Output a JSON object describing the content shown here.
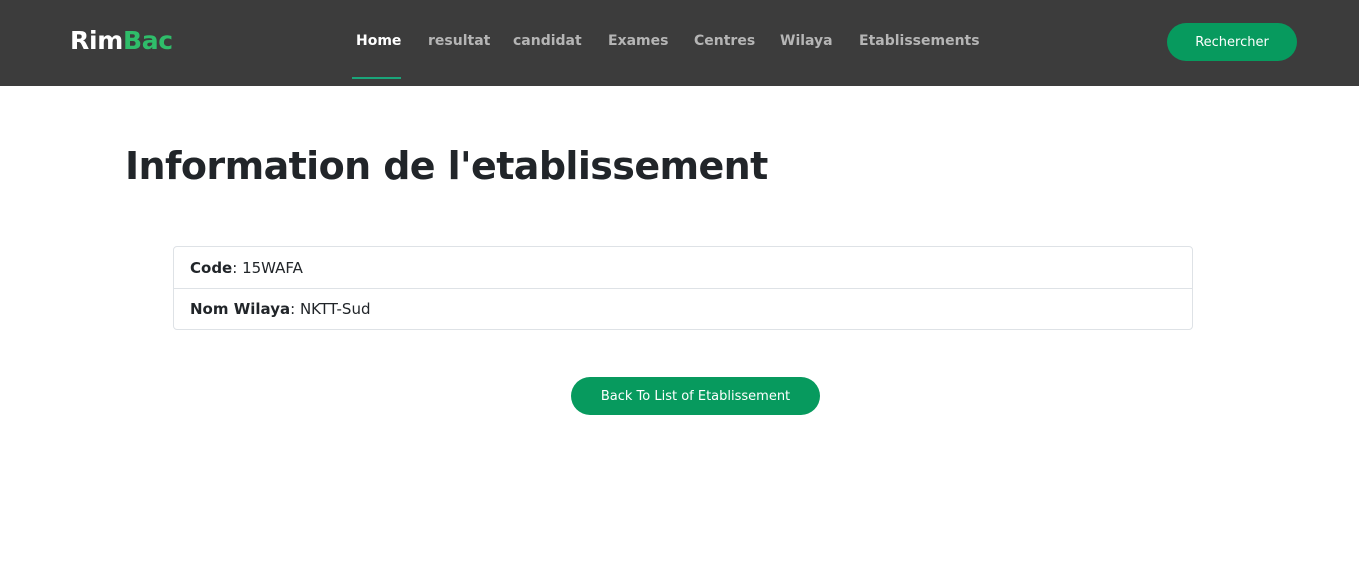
{
  "brand": {
    "part1": "Rim",
    "part2": "Bac",
    "part1_color": "#ffffff",
    "part2_color": "#2fbd6a"
  },
  "nav": {
    "items": [
      {
        "label": "Home",
        "active": true
      },
      {
        "label": "resultat",
        "active": false
      },
      {
        "label": "candidat",
        "active": false
      },
      {
        "label": "Exames",
        "active": false
      },
      {
        "label": "Centres",
        "active": false
      },
      {
        "label": "Wilaya",
        "active": false
      },
      {
        "label": "Etablissements",
        "active": false
      }
    ],
    "search_button_label": "Rechercher"
  },
  "main": {
    "title": "Information de l'etablissement",
    "details": [
      {
        "key": "Code",
        "separator": ": ",
        "value": "15WAFA"
      },
      {
        "key": "Nom Wilaya",
        "separator": ": ",
        "value": "NKTT-Sud"
      }
    ],
    "back_button_label": "Back To List of Etablissement"
  },
  "colors": {
    "navbar_bg": "#3c3c3c",
    "accent": "#079a5e",
    "active_underline": "#1aa57a",
    "nav_inactive": "#b5b5b5"
  }
}
